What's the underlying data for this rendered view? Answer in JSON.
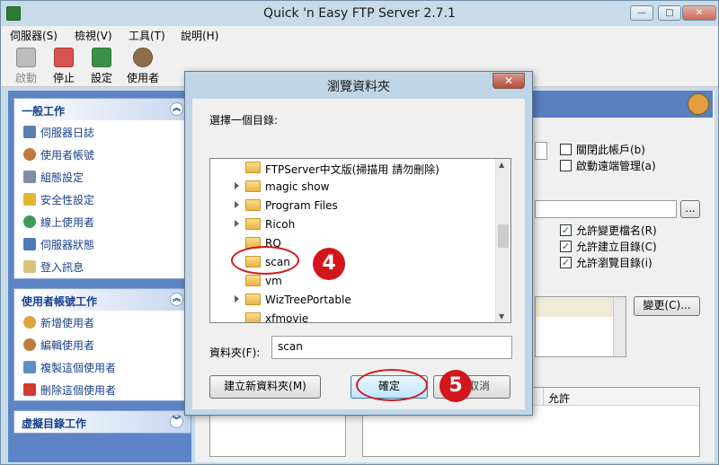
{
  "app": {
    "title": "Quick 'n Easy FTP Server 2.7.1",
    "window_buttons": {
      "minimize": "—",
      "maximize": "□",
      "close": "✕"
    }
  },
  "menu": [
    "伺服器(S)",
    "檢視(V)",
    "工具(T)",
    "說明(H)"
  ],
  "toolbar": [
    {
      "label": "啟動",
      "icon": "play-icon",
      "color": "#8c8c8c"
    },
    {
      "label": "停止",
      "icon": "stop-icon",
      "color": "#d9534f"
    },
    {
      "label": "設定",
      "icon": "settings-icon",
      "color": "#2e7d32"
    },
    {
      "label": "使用者",
      "icon": "users-icon",
      "color": "#6a4c2a"
    }
  ],
  "sidebar": {
    "groups": [
      {
        "title": "一般工作",
        "items": [
          "伺服器日誌",
          "使用者帳號",
          "組態設定",
          "安全性設定",
          "線上使用者",
          "伺服器狀態",
          "登入訊息"
        ]
      },
      {
        "title": "使用者帳號工作",
        "items": [
          "新增使用者",
          "編輯使用者",
          "複製這個使用者",
          "刪除這個使用者"
        ]
      },
      {
        "title": "虛擬目錄工作",
        "items": []
      }
    ]
  },
  "right_panel": {
    "checkboxes_top": [
      {
        "label": "關閉此帳戶(b)",
        "checked": false
      },
      {
        "label": "啟動遠端管理(a)",
        "checked": false
      }
    ],
    "browse_button": "...",
    "checkboxes_perm": [
      {
        "label": "允許變更檔名(R)",
        "checked": true
      },
      {
        "label": "允許建立目錄(C)",
        "checked": true
      },
      {
        "label": "允許瀏覽目錄(i)",
        "checked": true
      }
    ],
    "change_button": "變更(C)...",
    "table_header": "允許"
  },
  "dialog": {
    "title": "瀏覽資料夾",
    "close": "✕",
    "prompt": "選擇一個目錄:",
    "tree": [
      {
        "label": "FTPServer中文版(掃描用 請勿刪除)",
        "expandable": false
      },
      {
        "label": "magic show",
        "expandable": true
      },
      {
        "label": "Program Files",
        "expandable": true
      },
      {
        "label": "Ricoh",
        "expandable": true
      },
      {
        "label": "RQ",
        "expandable": false
      },
      {
        "label": "scan",
        "expandable": false
      },
      {
        "label": "vm",
        "expandable": false
      },
      {
        "label": "WizTreePortable",
        "expandable": true
      },
      {
        "label": "xfmovie",
        "expandable": false
      }
    ],
    "folder_label": "資料夾(F):",
    "folder_value": "scan",
    "new_folder_button": "建立新資料夾(M)",
    "ok_button": "確定",
    "cancel_button": "取消"
  },
  "annotations": [
    {
      "number": "4"
    },
    {
      "number": "5"
    }
  ],
  "colors": {
    "callout": "#d3161b",
    "sidebar_bg": "#5c84c6",
    "group_title": "#17408f"
  }
}
